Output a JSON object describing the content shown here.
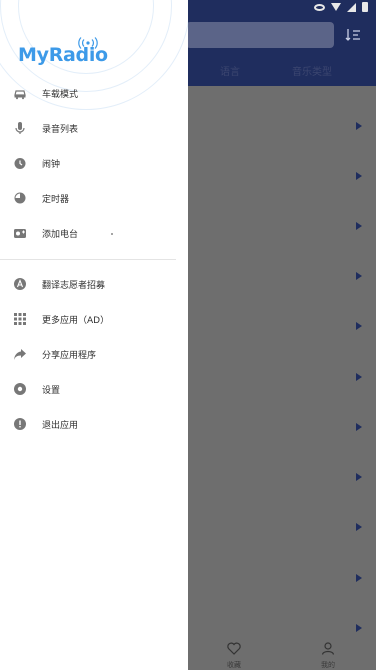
{
  "app": {
    "logo_text": "MyRadio",
    "brand_color": "#3d9ae8",
    "header_color": "#1f2d5e"
  },
  "background": {
    "tabs": [
      "语言",
      "音乐类型"
    ],
    "bottom_nav": [
      {
        "label": "收藏",
        "icon": "heart-icon"
      },
      {
        "label": "我的",
        "icon": "person-icon"
      }
    ]
  },
  "drawer": {
    "items": [
      {
        "label": "车载模式",
        "icon": "car-icon"
      },
      {
        "label": "录音列表",
        "icon": "microphone-icon"
      },
      {
        "label": "闹钟",
        "icon": "alarm-clock-icon"
      },
      {
        "label": "定时器",
        "icon": "timer-icon"
      },
      {
        "label": "添加电台",
        "icon": "add-station-icon"
      },
      {
        "label": "翻译志愿者招募",
        "icon": "translate-icon"
      },
      {
        "label": "更多应用（AD）",
        "icon": "apps-grid-icon"
      },
      {
        "label": "分享应用程序",
        "icon": "share-icon"
      },
      {
        "label": "设置",
        "icon": "settings-icon"
      },
      {
        "label": "退出应用",
        "icon": "exit-icon"
      }
    ]
  }
}
